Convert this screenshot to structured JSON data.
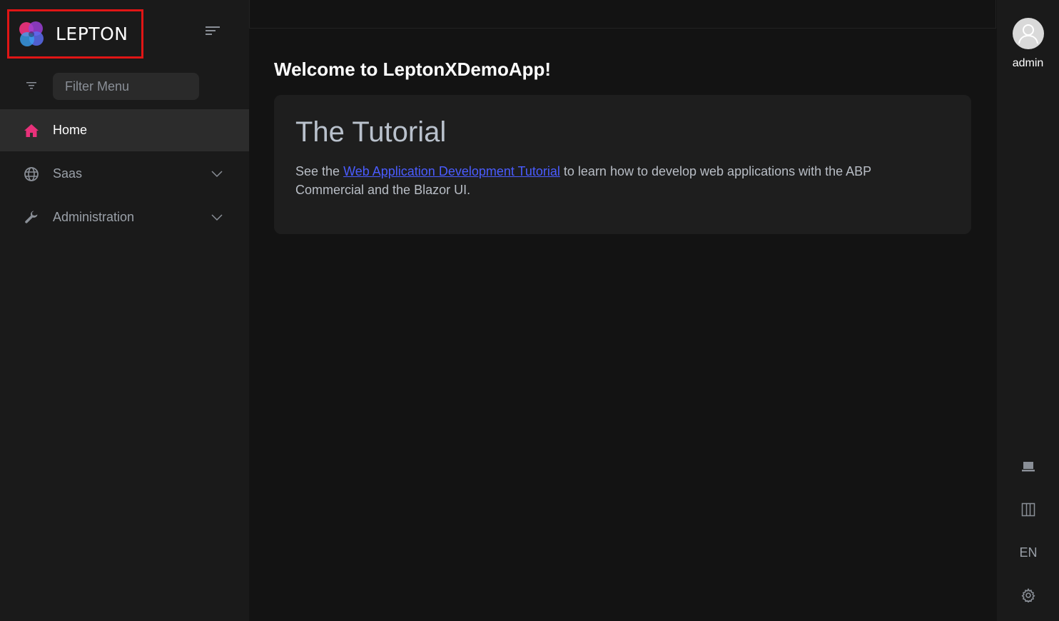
{
  "brand": {
    "name": "LEPTON"
  },
  "sidebar": {
    "filter_placeholder": "Filter Menu",
    "items": [
      {
        "label": "Home",
        "icon": "home-icon",
        "active": true,
        "has_children": false
      },
      {
        "label": "Saas",
        "icon": "globe-icon",
        "active": false,
        "has_children": true
      },
      {
        "label": "Administration",
        "icon": "wrench-icon",
        "active": false,
        "has_children": true
      }
    ]
  },
  "main": {
    "title": "Welcome to LeptonXDemoApp!",
    "card": {
      "heading": "The Tutorial",
      "text_before": "See the ",
      "link_text": "Web Application Development Tutorial",
      "text_after": " to learn how to develop web applications with the ABP Commercial and the Blazor UI."
    }
  },
  "rightbar": {
    "user_name": "admin",
    "language": "EN",
    "buttons": [
      "laptop-icon",
      "columns-icon",
      "language",
      "settings-gear-icon"
    ]
  },
  "colors": {
    "accent": "#e8317a",
    "link": "#4a5cff",
    "highlight_border": "#e01515"
  }
}
